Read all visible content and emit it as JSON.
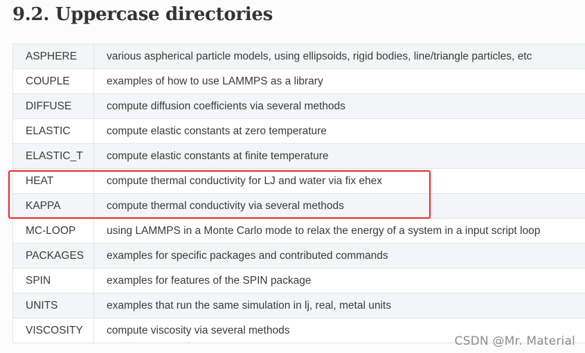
{
  "heading": "9.2. Uppercase directories",
  "rows": [
    {
      "name": "ASPHERE",
      "description": "various aspherical particle models, using ellipsoids, rigid bodies, line/triangle particles, etc"
    },
    {
      "name": "COUPLE",
      "description": "examples of how to use LAMMPS as a library"
    },
    {
      "name": "DIFFUSE",
      "description": "compute diffusion coefficients via several methods"
    },
    {
      "name": "ELASTIC",
      "description": "compute elastic constants at zero temperature"
    },
    {
      "name": "ELASTIC_T",
      "description": "compute elastic constants at finite temperature"
    },
    {
      "name": "HEAT",
      "description": "compute thermal conductivity for LJ and water via fix ehex"
    },
    {
      "name": "KAPPA",
      "description": "compute thermal conductivity via several methods"
    },
    {
      "name": "MC-LOOP",
      "description": "using LAMMPS in a Monte Carlo mode to relax the energy of a system in a input script loop"
    },
    {
      "name": "PACKAGES",
      "description": "examples for specific packages and contributed commands"
    },
    {
      "name": "SPIN",
      "description": "examples for features of the SPIN package"
    },
    {
      "name": "UNITS",
      "description": "examples that run the same simulation in lj, real, metal units"
    },
    {
      "name": "VISCOSITY",
      "description": "compute viscosity via several methods"
    }
  ],
  "watermark": "CSDN @Mr. Material",
  "colors": {
    "highlight_border": "#e8262a",
    "row_odd": "#f3f6f6",
    "row_even": "#ffffff",
    "border": "#e1e4e5"
  }
}
